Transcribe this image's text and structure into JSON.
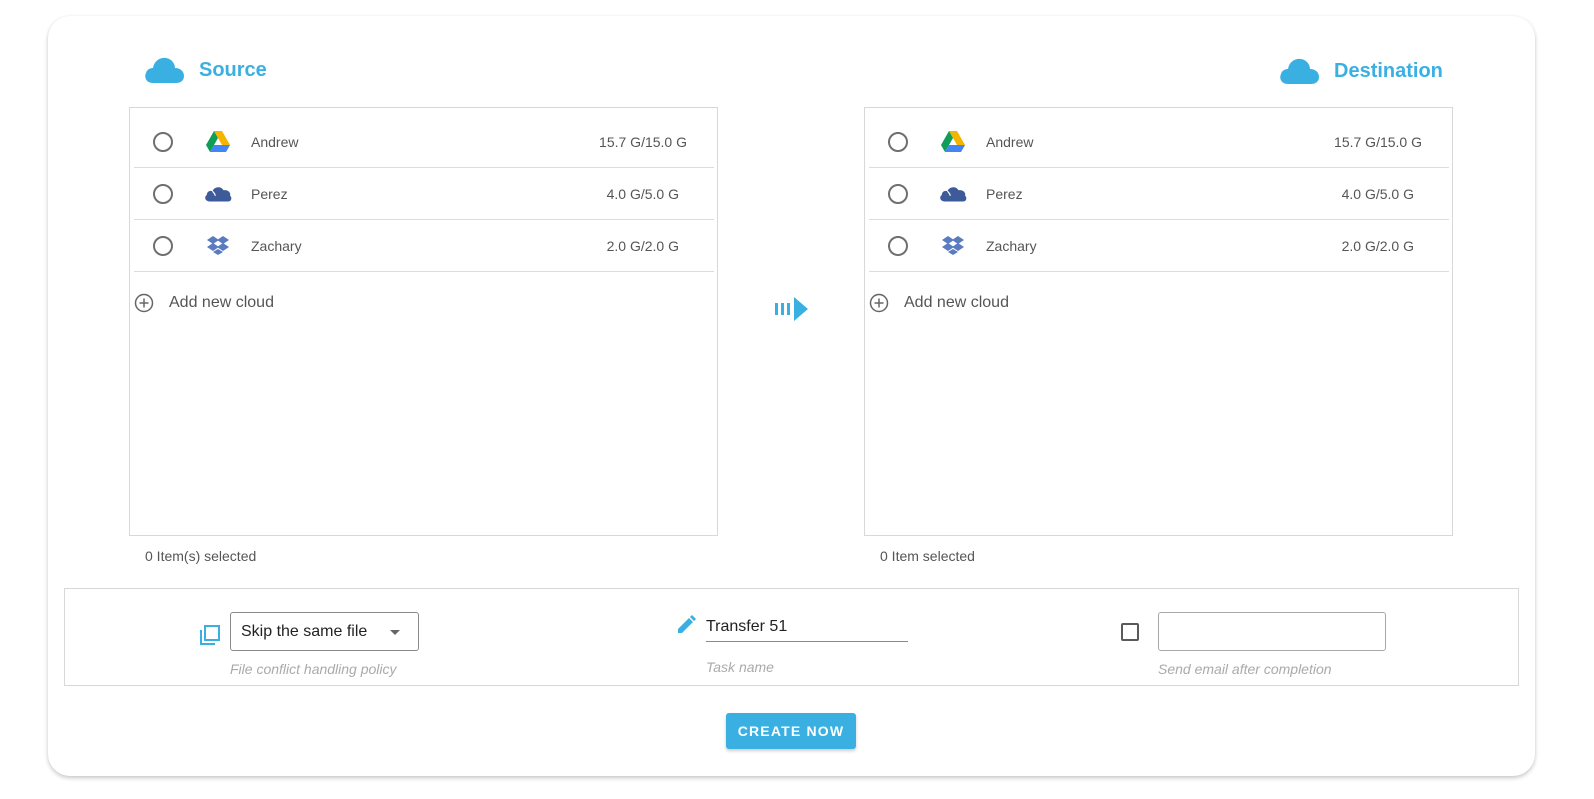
{
  "source": {
    "title": "Source",
    "accounts": [
      {
        "name": "Andrew",
        "icon": "google-drive-icon",
        "size": "15.7 G/15.0 G"
      },
      {
        "name": "Perez",
        "icon": "onedrive-icon",
        "size": "4.0 G/5.0 G"
      },
      {
        "name": "Zachary",
        "icon": "dropbox-icon",
        "size": "2.0 G/2.0 G"
      }
    ],
    "add_label": "Add new cloud",
    "selected_text": "0 Item(s) selected"
  },
  "destination": {
    "title": "Destination",
    "accounts": [
      {
        "name": "Andrew",
        "icon": "google-drive-icon",
        "size": "15.7 G/15.0 G"
      },
      {
        "name": "Perez",
        "icon": "onedrive-icon",
        "size": "4.0 G/5.0 G"
      },
      {
        "name": "Zachary",
        "icon": "dropbox-icon",
        "size": "2.0 G/2.0 G"
      }
    ],
    "add_label": "Add new cloud",
    "selected_text": "0 Item selected"
  },
  "options": {
    "conflict_policy_value": "Skip the same file",
    "conflict_policy_hint": "File conflict handling policy",
    "task_name_value": "Transfer 51",
    "task_name_hint": "Task name",
    "email_value": "",
    "email_hint": "Send email after completion"
  },
  "create_button": "CREATE NOW",
  "colors": {
    "accent": "#3ab0e2",
    "onedrive": "#3d5a99",
    "dropbox": "#5b7bc1"
  }
}
